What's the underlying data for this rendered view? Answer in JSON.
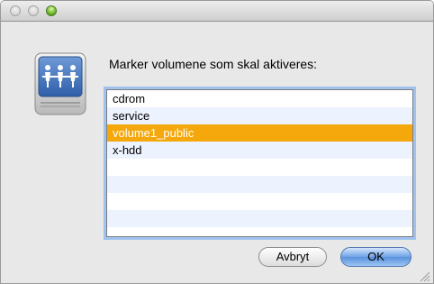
{
  "window": {
    "buttons": [
      "close",
      "minimize",
      "zoom"
    ]
  },
  "dialog": {
    "icon": "shared-network-volume-icon",
    "prompt": "Marker volumene som skal aktiveres:",
    "volumes": [
      {
        "label": "cdrom",
        "selected": false
      },
      {
        "label": "service",
        "selected": false
      },
      {
        "label": "volume1_public",
        "selected": true
      },
      {
        "label": "x-hdd",
        "selected": false
      }
    ],
    "cancel_label": "Avbryt",
    "ok_label": "OK"
  },
  "colors": {
    "selection": "#f4a80c",
    "alternate_row": "#edf3fe",
    "focus_ring": "#9fc2ef",
    "default_button": "#6fa2e6"
  }
}
